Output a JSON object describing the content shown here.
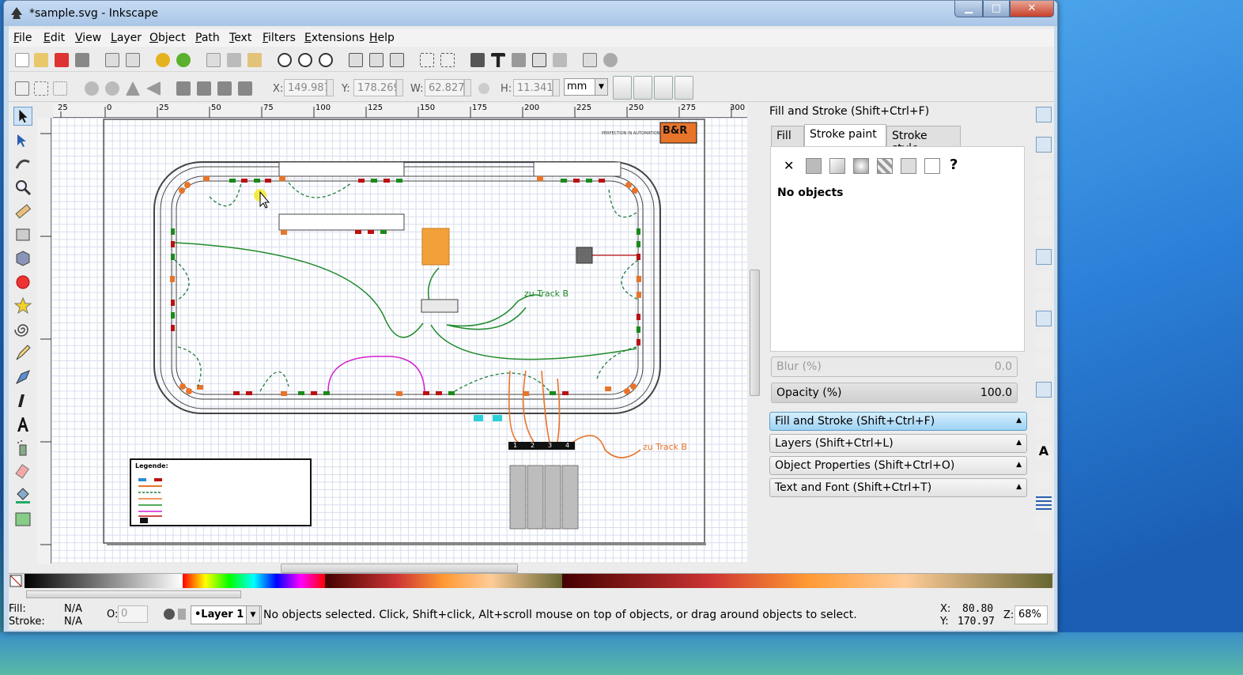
{
  "window": {
    "title": "*sample.svg - Inkscape",
    "minimize": "▁",
    "maximize": "□",
    "close": "✕"
  },
  "menu": [
    "File",
    "Edit",
    "View",
    "Layer",
    "Object",
    "Path",
    "Text",
    "Filters",
    "Extensions",
    "Help"
  ],
  "controls": {
    "x_label": "X:",
    "x_value": "149.987",
    "y_label": "Y:",
    "y_value": "178.269",
    "w_label": "W:",
    "w_value": "62.827",
    "h_label": "H:",
    "h_value": "11.341",
    "unit": "mm"
  },
  "ruler_labels": [
    "25",
    "0",
    "25",
    "50",
    "75",
    "100",
    "125",
    "150",
    "175",
    "200",
    "225",
    "250",
    "275",
    "300"
  ],
  "drawing": {
    "label_track_b_1": "zu Track B",
    "label_track_b_2": "zu Track B",
    "logo_text": "B&R",
    "logo_tagline": "PERFECTION IN AUTOMATION",
    "legend_title": "Legende:",
    "module_numbers": [
      "1",
      "2",
      "3",
      "4"
    ]
  },
  "panel": {
    "title": "Fill and Stroke (Shift+Ctrl+F)",
    "tabs": [
      "Fill",
      "Stroke paint",
      "Stroke style"
    ],
    "no_objects": "No objects",
    "blur_label": "Blur (%)",
    "blur_value": "0.0",
    "opacity_label": "Opacity (%)",
    "opacity_value": "100.0",
    "paint_none": "✕",
    "paint_unknown": "?",
    "docked": [
      "Fill and Stroke (Shift+Ctrl+F)",
      "Layers (Shift+Ctrl+L)",
      "Object Properties (Shift+Ctrl+O)",
      "Text and Font (Shift+Ctrl+T)"
    ]
  },
  "status": {
    "fill_label": "Fill:",
    "fill_value": "N/A",
    "stroke_label": "Stroke:",
    "stroke_value": "N/A",
    "opacity_label": "O:",
    "opacity_value": "0",
    "layer": "•Layer 1",
    "message": "No objects selected. Click, Shift+click, Alt+scroll mouse on top of objects, or drag around objects to select.",
    "x_label": "X:",
    "x_value": "80.80",
    "y_label": "Y:",
    "y_value": "170.97",
    "zoom_label": "Z:",
    "zoom_value": "68%"
  },
  "colors": {
    "accent": "#9dd2f3",
    "track": "#333333",
    "orange": "#e8742a",
    "green": "#2a8a2a",
    "magenta": "#d21fd2"
  }
}
